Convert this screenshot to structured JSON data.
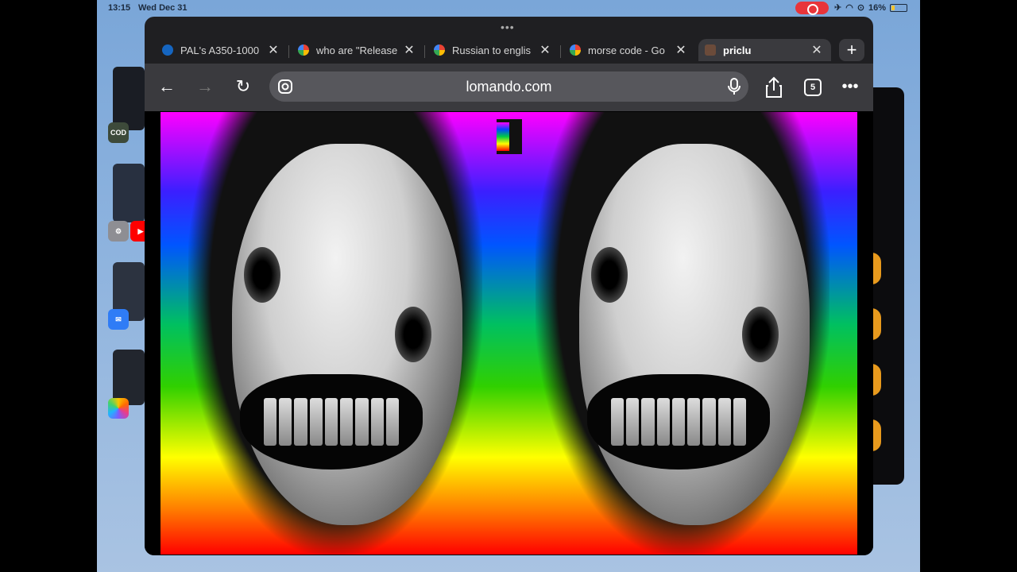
{
  "status_bar": {
    "time": "13:15",
    "date": "Wed Dec 31",
    "battery": "16%"
  },
  "dock_apps": [
    "Call of Duty",
    "Settings",
    "YouTube",
    "Messenger",
    "Photos"
  ],
  "browser": {
    "tabs": [
      {
        "title": "PAL's A350-1000",
        "favicon": "pal-icon",
        "active": false
      },
      {
        "title": "who are \"Releasе",
        "favicon": "google-icon",
        "active": false
      },
      {
        "title": "Russian to englis",
        "favicon": "google-icon",
        "active": false
      },
      {
        "title": "morse code - Go",
        "favicon": "google-icon",
        "active": false
      },
      {
        "title": "priclu",
        "favicon": "priclu-icon",
        "active": true
      }
    ],
    "new_tab_label": "+",
    "url": "lomando.com",
    "tab_count": "5"
  },
  "colors": {
    "record_indicator": "#e8343a",
    "toolbar": "#3a3a3e",
    "tab_bar": "#1f1f22",
    "battery_low": "#f4c430"
  }
}
